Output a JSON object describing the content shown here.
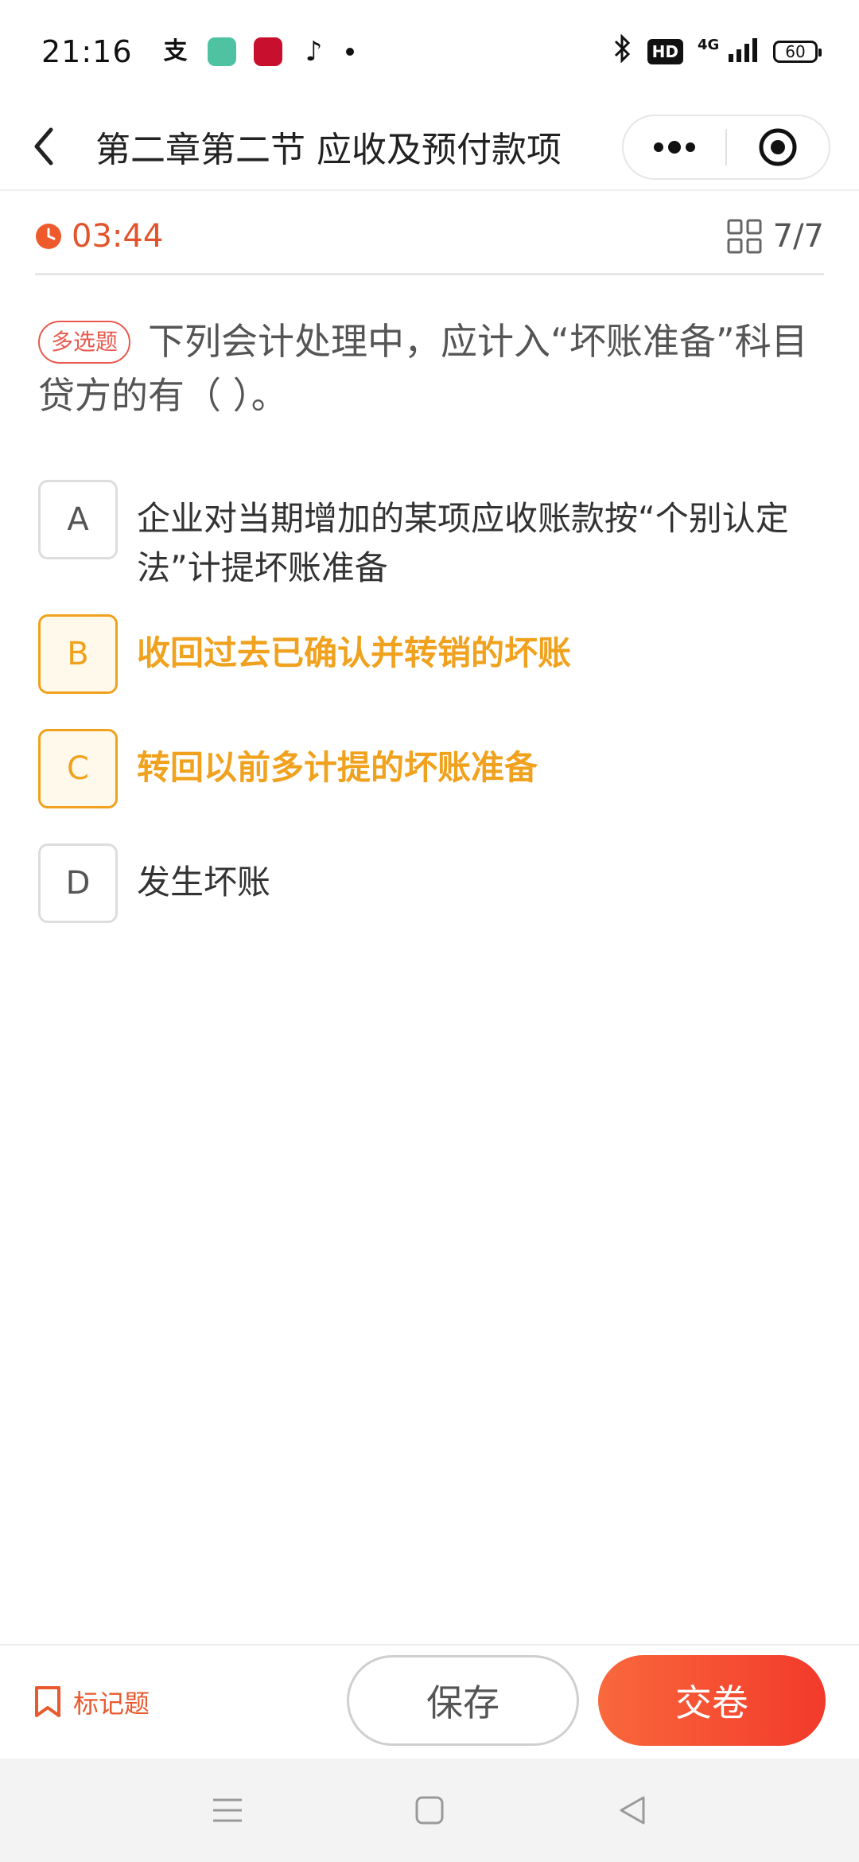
{
  "status_bar": {
    "time": "21:16",
    "apps": [
      "alipay-icon",
      "green-app-icon",
      "bank-app-icon",
      "tiktok-icon"
    ],
    "hd": "HD",
    "signal": "4G",
    "battery": "60"
  },
  "nav": {
    "title": "第二章第二节 应收及预付款项"
  },
  "quiz": {
    "timer": "03:44",
    "progress": "7/7",
    "question_type": "多选题",
    "question_text": "下列会计处理中，应计入“坏账准备”科目贷方的有（   ）。",
    "options": [
      {
        "letter": "A",
        "text": "企业对当期增加的某项应收账款按“个别认定法”计提坏账准备",
        "selected": false
      },
      {
        "letter": "B",
        "text": "收回过去已确认并转销的坏账",
        "selected": true
      },
      {
        "letter": "C",
        "text": "转回以前多计提的坏账准备",
        "selected": true
      },
      {
        "letter": "D",
        "text": "发生坏账",
        "selected": false
      }
    ]
  },
  "bottom": {
    "mark_label": "标记题",
    "save_label": "保存",
    "submit_label": "交卷"
  },
  "colors": {
    "accent_orange": "#f0a21e",
    "timer_red": "#e2532b",
    "submit_gradient_start": "#f9683c",
    "submit_gradient_end": "#f23a2b"
  }
}
